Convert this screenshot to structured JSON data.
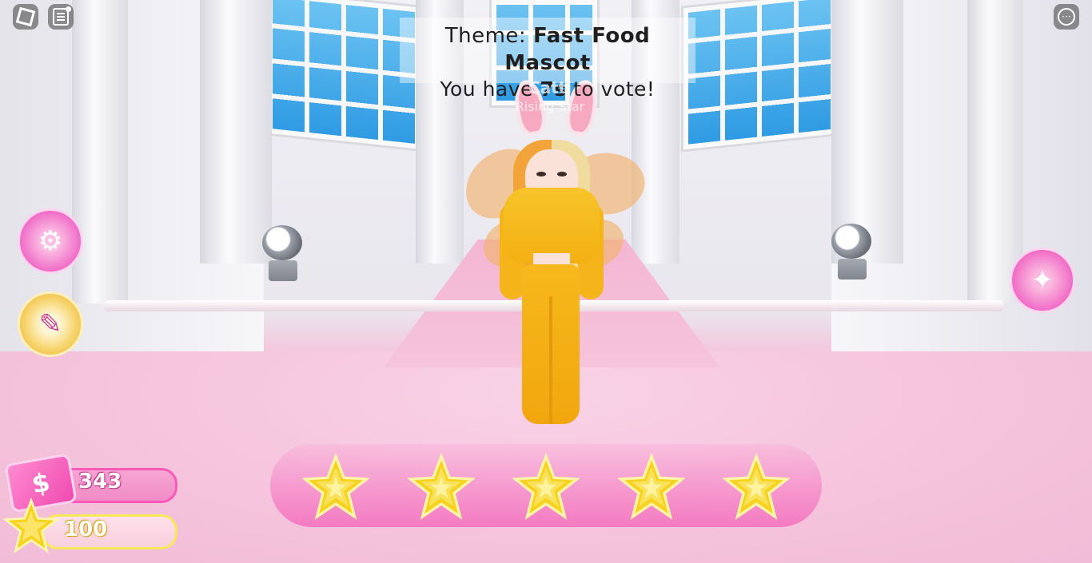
{
  "hud": {
    "theme_prefix": "Theme:",
    "theme_value": "Fast Food Mascot",
    "vote_prefix": "You have",
    "vote_time": "7s",
    "vote_suffix": "to vote!"
  },
  "player": {
    "name": "Catti",
    "title": "Rising Star"
  },
  "topbar": {
    "menu_icon": "roblox-logo-icon",
    "chat_icon": "chat-icon",
    "more_icon": "more-options-icon"
  },
  "side_buttons": {
    "left": [
      "settings-gears-icon",
      "outfit-tools-icon"
    ],
    "right": [
      "pose-dancer-icon"
    ]
  },
  "currency": {
    "money": "343",
    "stars": "100"
  },
  "rating": {
    "star_count": 5,
    "selected": 0,
    "star_icon": "star-icon"
  },
  "colors": {
    "accent_pink": "#f06cc8",
    "star_gold": "#f7d21e",
    "money_border": "#fb59b8",
    "stars_border": "#f7e85a"
  }
}
